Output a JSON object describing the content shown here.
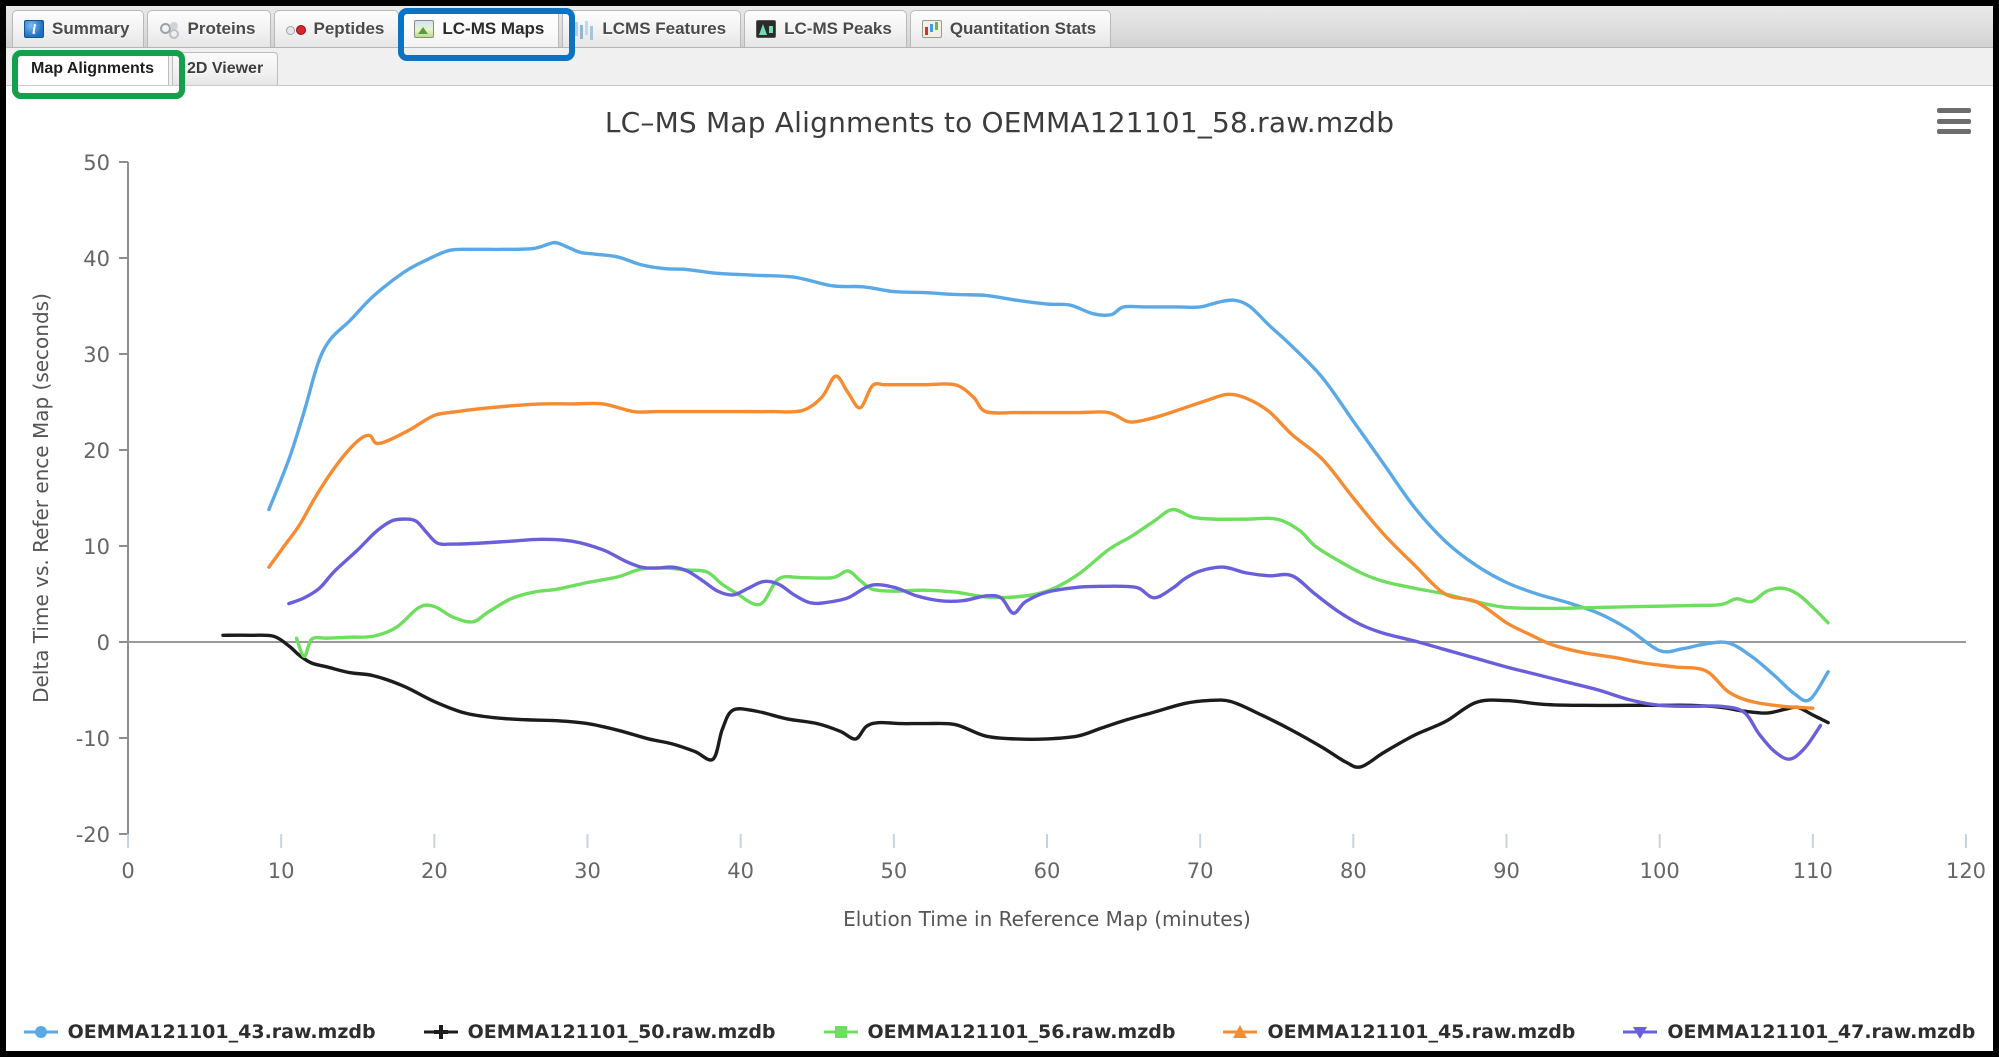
{
  "window": {
    "main_tabs": [
      {
        "label": "Summary",
        "icon": "info-circle-icon",
        "icon_class": "ic-summary",
        "active": false
      },
      {
        "label": "Proteins",
        "icon": "protein-icon",
        "icon_class": "ic-proteins",
        "active": false
      },
      {
        "label": "Peptides",
        "icon": "peptide-icon",
        "icon_class": "ic-peptides",
        "active": false
      },
      {
        "label": "LC-MS Maps",
        "icon": "map-image-icon",
        "icon_class": "ic-lcmsmaps",
        "active": true
      },
      {
        "label": "LCMS Features",
        "icon": "features-bars-icon",
        "icon_class": "ic-lcmsfeat",
        "active": false
      },
      {
        "label": "LC-MS Peaks",
        "icon": "peaks-chart-icon",
        "icon_class": "ic-lcmspeaks",
        "active": false
      },
      {
        "label": "Quantitation Stats",
        "icon": "bar-chart-icon",
        "icon_class": "ic-quant",
        "active": false
      }
    ],
    "sub_tabs": [
      {
        "label": "Map Alignments",
        "active": true
      },
      {
        "label": "2D Viewer",
        "active": false
      }
    ],
    "highlights": {
      "blue_ring_target": "LC-MS Maps",
      "blue_ring_color": "#0b72c4",
      "green_ring_target": "Map Alignments",
      "green_ring_color": "#12a04a"
    },
    "menu_button": "chart-context-menu"
  },
  "chart_data": {
    "type": "line",
    "title": "LC–MS Map Alignments to OEMMA121101_58.raw.mzdb",
    "xlabel": "Elution Time in Reference Map (minutes)",
    "ylabel": "Delta Time vs. Refer ence Map (seconds)",
    "xlim": [
      0,
      120
    ],
    "ylim": [
      -20,
      50
    ],
    "xticks": [
      0,
      10,
      20,
      30,
      40,
      50,
      60,
      70,
      80,
      90,
      100,
      110,
      120
    ],
    "yticks": [
      -20,
      -10,
      0,
      10,
      20,
      30,
      40,
      50
    ],
    "grid": false,
    "zero_line": true,
    "legend_position": "bottom",
    "series": [
      {
        "name": "OEMMA121101_43.raw.mzdb",
        "color": "#5aa9e6",
        "marker": "circle",
        "x": [
          9.2,
          10.5,
          11.5,
          12.4,
          13.2,
          14.5,
          16.0,
          18.0,
          19.5,
          21.0,
          22.5,
          24.5,
          26.5,
          27.8,
          28.6,
          29.5,
          30.5,
          32.0,
          33.5,
          35.0,
          36.5,
          38.5,
          41.0,
          43.5,
          46.0,
          48.0,
          50.0,
          52.0,
          54.0,
          56.0,
          58.0,
          60.0,
          61.5,
          63.0,
          64.2,
          65.0,
          66.5,
          68.5,
          70.0,
          71.2,
          72.2,
          73.2,
          74.5,
          76.0,
          78.0,
          80.0,
          82.0,
          84.0,
          86.0,
          88.0,
          90.0,
          92.0,
          94.0,
          96.0,
          98.0,
          100.0,
          101.5,
          103.0,
          104.5,
          106.0,
          107.5,
          108.8,
          109.8,
          111.0
        ],
        "y": [
          13.8,
          19.0,
          24.0,
          29.0,
          31.5,
          33.5,
          36.0,
          38.5,
          39.8,
          40.8,
          40.9,
          40.9,
          41.0,
          41.6,
          41.2,
          40.6,
          40.4,
          40.1,
          39.3,
          38.9,
          38.8,
          38.4,
          38.2,
          38.0,
          37.1,
          37.0,
          36.5,
          36.4,
          36.2,
          36.1,
          35.6,
          35.2,
          35.1,
          34.2,
          34.1,
          34.9,
          34.9,
          34.9,
          34.9,
          35.4,
          35.6,
          35.0,
          33.0,
          30.8,
          27.5,
          23.0,
          18.5,
          14.0,
          10.5,
          8.0,
          6.2,
          5.0,
          4.1,
          3.0,
          1.3,
          -0.9,
          -0.7,
          -0.2,
          -0.1,
          -1.5,
          -3.5,
          -5.4,
          -6.0,
          -3.1
        ]
      },
      {
        "name": "OEMMA121101_50.raw.mzdb",
        "color": "#1c1c1c",
        "marker": "cross",
        "x": [
          6.2,
          8.0,
          9.5,
          10.5,
          11.2,
          12.0,
          13.0,
          14.5,
          16.0,
          18.0,
          20.0,
          22.0,
          24.0,
          26.0,
          28.0,
          30.0,
          32.0,
          34.0,
          35.5,
          37.0,
          38.2,
          38.8,
          39.5,
          41.0,
          43.0,
          45.0,
          46.5,
          47.5,
          48.2,
          49.0,
          50.5,
          52.0,
          54.0,
          56.0,
          58.0,
          60.0,
          62.0,
          63.5,
          65.0,
          67.0,
          69.0,
          70.5,
          72.0,
          74.0,
          76.0,
          78.0,
          79.5,
          80.5,
          82.0,
          84.0,
          86.0,
          88.0,
          90.0,
          92.5,
          95.0,
          98.0,
          100.0,
          102.0,
          104.0,
          105.5,
          107.0,
          108.2,
          109.0,
          110.0,
          111.0
        ],
        "y": [
          0.7,
          0.7,
          0.6,
          -0.4,
          -1.4,
          -2.2,
          -2.6,
          -3.2,
          -3.5,
          -4.6,
          -6.2,
          -7.4,
          -7.9,
          -8.1,
          -8.2,
          -8.5,
          -9.2,
          -10.1,
          -10.6,
          -11.4,
          -12.2,
          -9.1,
          -7.1,
          -7.2,
          -8.0,
          -8.5,
          -9.3,
          -10.1,
          -8.8,
          -8.4,
          -8.5,
          -8.5,
          -8.6,
          -9.8,
          -10.1,
          -10.1,
          -9.8,
          -9.0,
          -8.2,
          -7.3,
          -6.4,
          -6.1,
          -6.2,
          -7.6,
          -9.2,
          -11.0,
          -12.5,
          -13.0,
          -11.5,
          -9.7,
          -8.3,
          -6.3,
          -6.1,
          -6.5,
          -6.6,
          -6.6,
          -6.6,
          -6.6,
          -6.8,
          -7.2,
          -7.4,
          -7.0,
          -6.8,
          -7.6,
          -8.4
        ]
      },
      {
        "name": "OEMMA121101_56.raw.mzdb",
        "color": "#6ede5e",
        "marker": "square",
        "x": [
          11.0,
          11.5,
          12.0,
          13.0,
          14.5,
          16.0,
          17.5,
          19.0,
          20.0,
          21.2,
          22.5,
          23.5,
          25.0,
          26.5,
          28.0,
          30.0,
          32.0,
          33.5,
          35.0,
          36.5,
          37.8,
          38.8,
          39.8,
          40.8,
          41.5,
          42.5,
          44.0,
          46.0,
          47.0,
          47.8,
          48.6,
          50.0,
          52.0,
          54.0,
          56.0,
          58.0,
          60.0,
          62.0,
          64.0,
          65.5,
          67.0,
          68.2,
          69.5,
          71.0,
          73.0,
          75.0,
          76.5,
          77.5,
          79.0,
          80.5,
          82.0,
          84.0,
          86.0,
          88.0,
          90.0,
          93.0,
          96.0,
          99.0,
          102.0,
          104.0,
          105.0,
          106.0,
          107.0,
          108.0,
          109.0,
          110.0,
          111.0
        ],
        "y": [
          0.4,
          -1.5,
          0.3,
          0.4,
          0.5,
          0.6,
          1.5,
          3.6,
          3.7,
          2.6,
          2.1,
          3.1,
          4.5,
          5.2,
          5.5,
          6.2,
          6.8,
          7.6,
          7.7,
          7.5,
          7.3,
          6.0,
          5.0,
          4.0,
          4.2,
          6.6,
          6.7,
          6.7,
          7.4,
          6.4,
          5.5,
          5.3,
          5.4,
          5.2,
          4.7,
          4.7,
          5.3,
          7.0,
          9.6,
          11.0,
          12.6,
          13.8,
          13.0,
          12.8,
          12.8,
          12.8,
          11.6,
          10.0,
          8.5,
          7.2,
          6.3,
          5.6,
          5.0,
          4.2,
          3.6,
          3.5,
          3.6,
          3.7,
          3.8,
          3.9,
          4.5,
          4.2,
          5.3,
          5.6,
          5.0,
          3.6,
          2.0
        ]
      },
      {
        "name": "OEMMA121101_45.raw.mzdb",
        "color": "#f68b31",
        "marker": "triangle",
        "x": [
          9.2,
          10.2,
          11.2,
          12.2,
          13.2,
          14.3,
          15.2,
          15.8,
          16.2,
          17.0,
          18.5,
          20.0,
          21.5,
          23.0,
          25.0,
          27.0,
          29.0,
          31.0,
          33.0,
          34.5,
          36.0,
          38.0,
          40.0,
          42.0,
          44.0,
          45.3,
          46.2,
          47.0,
          47.8,
          48.6,
          49.4,
          50.2,
          52.0,
          54.0,
          55.2,
          56.0,
          58.0,
          60.0,
          62.0,
          64.0,
          65.2,
          66.0,
          67.5,
          69.0,
          70.5,
          71.8,
          73.0,
          74.5,
          76.0,
          78.0,
          80.0,
          82.0,
          84.0,
          86.0,
          88.0,
          90.0,
          91.5,
          93.0,
          95.0,
          97.0,
          99.0,
          101.0,
          103.0,
          104.5,
          106.0,
          108.0,
          109.0,
          110.0
        ],
        "y": [
          7.8,
          10.0,
          12.2,
          15.0,
          17.5,
          19.8,
          21.2,
          21.5,
          20.7,
          21.0,
          22.2,
          23.6,
          24.0,
          24.3,
          24.6,
          24.8,
          24.8,
          24.8,
          24.0,
          24.0,
          24.0,
          24.0,
          24.0,
          24.0,
          24.1,
          25.5,
          27.7,
          26.0,
          24.4,
          26.7,
          26.8,
          26.8,
          26.8,
          26.8,
          25.5,
          24.0,
          23.9,
          23.9,
          23.9,
          23.9,
          23.0,
          23.0,
          23.6,
          24.4,
          25.2,
          25.8,
          25.4,
          24.0,
          21.6,
          19.0,
          15.0,
          11.2,
          8.0,
          5.0,
          4.2,
          2.0,
          0.8,
          -0.3,
          -1.1,
          -1.6,
          -2.2,
          -2.6,
          -3.0,
          -5.2,
          -6.2,
          -6.7,
          -6.8,
          -6.9
        ]
      },
      {
        "name": "OEMMA121101_47.raw.mzdb",
        "color": "#6a5fdb",
        "marker": "tri-down",
        "x": [
          10.5,
          11.5,
          12.5,
          13.5,
          15.0,
          16.2,
          17.2,
          18.0,
          18.8,
          19.5,
          20.2,
          21.2,
          23.0,
          25.0,
          27.0,
          29.0,
          31.0,
          32.5,
          33.5,
          34.5,
          35.5,
          36.5,
          37.5,
          38.5,
          39.5,
          40.5,
          41.5,
          42.5,
          43.5,
          44.5,
          45.5,
          47.0,
          48.5,
          50.0,
          51.5,
          53.0,
          54.5,
          56.0,
          57.0,
          57.8,
          58.6,
          60.0,
          62.0,
          63.5,
          65.0,
          66.0,
          67.0,
          68.2,
          69.0,
          70.0,
          71.5,
          73.0,
          74.5,
          76.0,
          77.5,
          79.0,
          80.5,
          82.0,
          84.0,
          86.0,
          88.0,
          90.0,
          92.0,
          94.0,
          96.0,
          98.0,
          100.0,
          102.0,
          104.0,
          105.5,
          106.5,
          107.5,
          108.5,
          109.5,
          110.5
        ],
        "y": [
          4.0,
          4.6,
          5.6,
          7.4,
          9.6,
          11.5,
          12.6,
          12.8,
          12.6,
          11.4,
          10.3,
          10.2,
          10.3,
          10.5,
          10.7,
          10.5,
          9.6,
          8.4,
          7.8,
          7.7,
          7.8,
          7.4,
          6.4,
          5.3,
          4.9,
          5.6,
          6.3,
          6.0,
          4.9,
          4.1,
          4.1,
          4.6,
          5.9,
          5.7,
          4.8,
          4.3,
          4.3,
          4.8,
          4.6,
          3.0,
          4.2,
          5.2,
          5.7,
          5.8,
          5.8,
          5.6,
          4.6,
          5.6,
          6.6,
          7.4,
          7.8,
          7.2,
          6.9,
          6.9,
          5.0,
          3.2,
          1.8,
          0.9,
          0.1,
          -0.8,
          -1.7,
          -2.6,
          -3.4,
          -4.2,
          -5.0,
          -6.0,
          -6.6,
          -6.7,
          -6.7,
          -7.3,
          -9.6,
          -11.4,
          -12.2,
          -11.0,
          -8.7
        ]
      }
    ]
  }
}
